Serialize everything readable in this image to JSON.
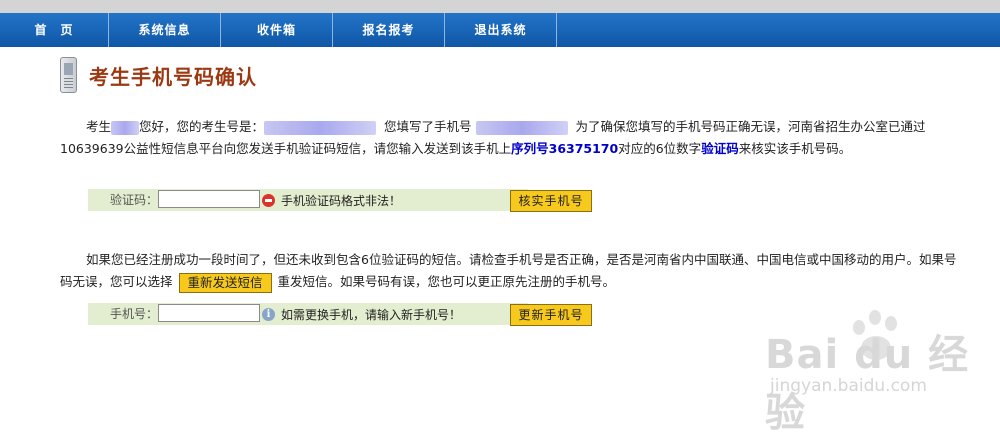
{
  "nav": {
    "items": [
      "首　页",
      "系统信息",
      "收件箱",
      "报名报考",
      "退出系统"
    ]
  },
  "page_title": "考生手机号码确认",
  "para1": {
    "part_a": "考生",
    "part_b": "您好，您的考生号是：",
    "part_c": "您填写了手机号",
    "part_d": "为了确保您填写的手机号码正确无误，河南省招生办公室已通过10639639公益性短信息平台向您发送手机验证码短信，请您输入发送到该手机上",
    "serial_label": "序列号36375170",
    "part_e": "对应的6位数字",
    "code_label": "验证码",
    "part_f": "来核实该手机号码。"
  },
  "verify_row": {
    "label": "验证码：",
    "input_value": "",
    "error_msg": "手机验证码格式非法！",
    "button": "核实手机号"
  },
  "para2": {
    "part_a": "如果您已经注册成功一段时间了，但还未收到包含6位验证码的短信。请检查手机号是否正确，是否是河南省内中国联通、中国电信或中国移动的用户。如果号码无误，您可以选择",
    "resend_button": "重新发送短信",
    "part_b": "重发短信。如果号码有误，您也可以更正原先注册的手机号。"
  },
  "phone_row": {
    "label": "手机号：",
    "input_value": "",
    "info_msg": "如需更换手机，请输入新手机号！",
    "button": "更新手机号"
  },
  "watermark": {
    "brand": "Bai du 经验",
    "url": "jingyan.baidu.com"
  },
  "colors": {
    "nav_bg": "#1a65b8",
    "title": "#9b3a12",
    "row_bg": "#e3edcf",
    "button_bg": "#f6c91c",
    "highlight": "#0000cc",
    "error_icon": "#d9332b"
  }
}
